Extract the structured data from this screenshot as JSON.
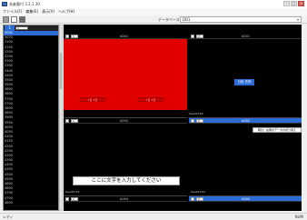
{
  "window": {
    "title": "長者番付 3.2.1.30",
    "btn_min": "–",
    "btn_max": "□",
    "btn_close": "×"
  },
  "menu": [
    "ファイル(F)",
    "編集(E)",
    "表示(V)",
    "ヘルプ(H)"
  ],
  "toolbar": {
    "db_label": "データベース",
    "db_value": "DB1",
    "chevron": "▾"
  },
  "left_panel": {
    "tab_label": "1",
    "field_value": "1",
    "rows": [
      "3000",
      "3070",
      "3100",
      "3150",
      "3200",
      "3250",
      "3300",
      "3350",
      "3400",
      "3450",
      "3500",
      "3550",
      "3600",
      "3650",
      "3700",
      "3750",
      "3800",
      "3850",
      "3900",
      "3950",
      "4000",
      "4050",
      "4100",
      "4150",
      "4200",
      "4250",
      "4300",
      "4350",
      "4400",
      "4450",
      "4500",
      "4550",
      "4600",
      "4650",
      "4700",
      "4750",
      "4800"
    ]
  },
  "panels": {
    "top_left": {
      "field": "1",
      "code": "A001",
      "btn1": "1日 3日",
      "btn2": "1日 3日"
    },
    "top_right": {
      "field": "2",
      "code": "A001",
      "button": "日経 先物"
    },
    "mid_left": {
      "field": "1",
      "code": "A002"
    },
    "mid_right": {
      "field": "2",
      "code": "A002",
      "caption": "SaveST-02",
      "info": "時計。右側のデータの切り替え"
    },
    "bottom_left": {
      "caption": "SaveST-01",
      "field": "1",
      "code": "A004"
    },
    "bottom_right": {
      "caption": "SaveST-04",
      "field": "2",
      "code": "A004"
    },
    "top_caption": "SaveST-02",
    "input_placeholder": "ここに文字を入力してください"
  },
  "status": {
    "left": "レディ",
    "right": "NUM"
  },
  "colors": {
    "accent_blue": "#2b6cd6",
    "red_panel": "#e00000",
    "panel_bg": "#000000"
  }
}
